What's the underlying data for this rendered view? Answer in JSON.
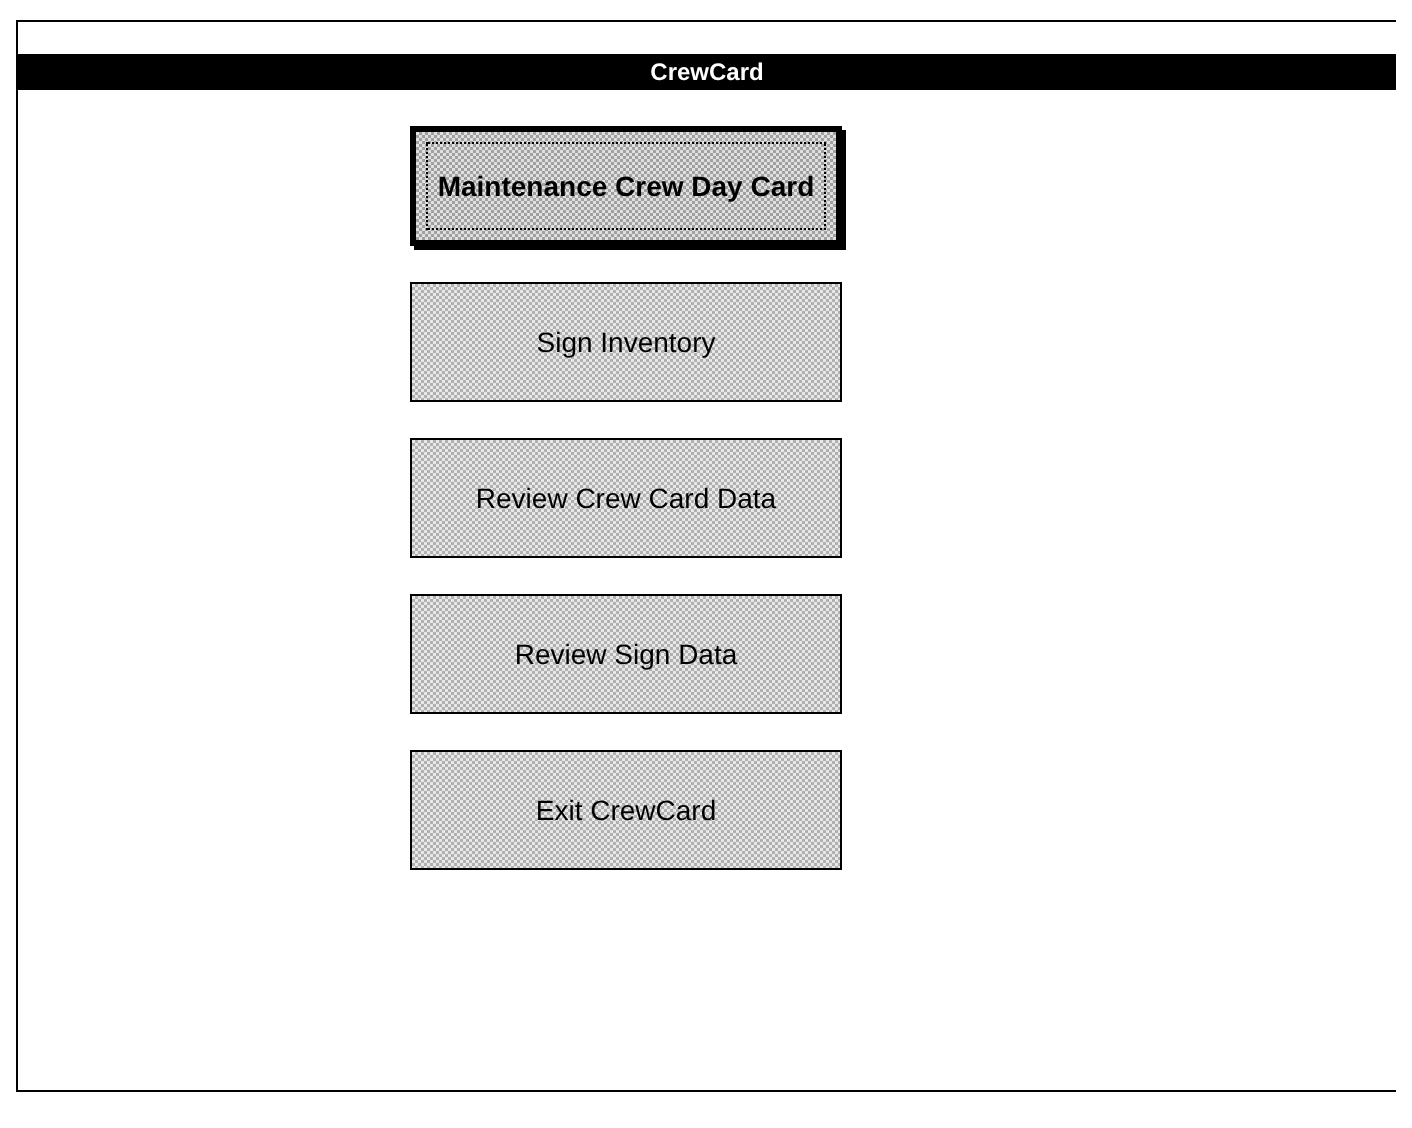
{
  "window": {
    "title": "CrewCard"
  },
  "buttons": [
    {
      "label": "Maintenance Crew Day Card",
      "focused": true
    },
    {
      "label": "Sign Inventory",
      "focused": false
    },
    {
      "label": "Review Crew Card Data",
      "focused": false
    },
    {
      "label": "Review Sign Data",
      "focused": false
    },
    {
      "label": "Exit CrewCard",
      "focused": false
    }
  ]
}
